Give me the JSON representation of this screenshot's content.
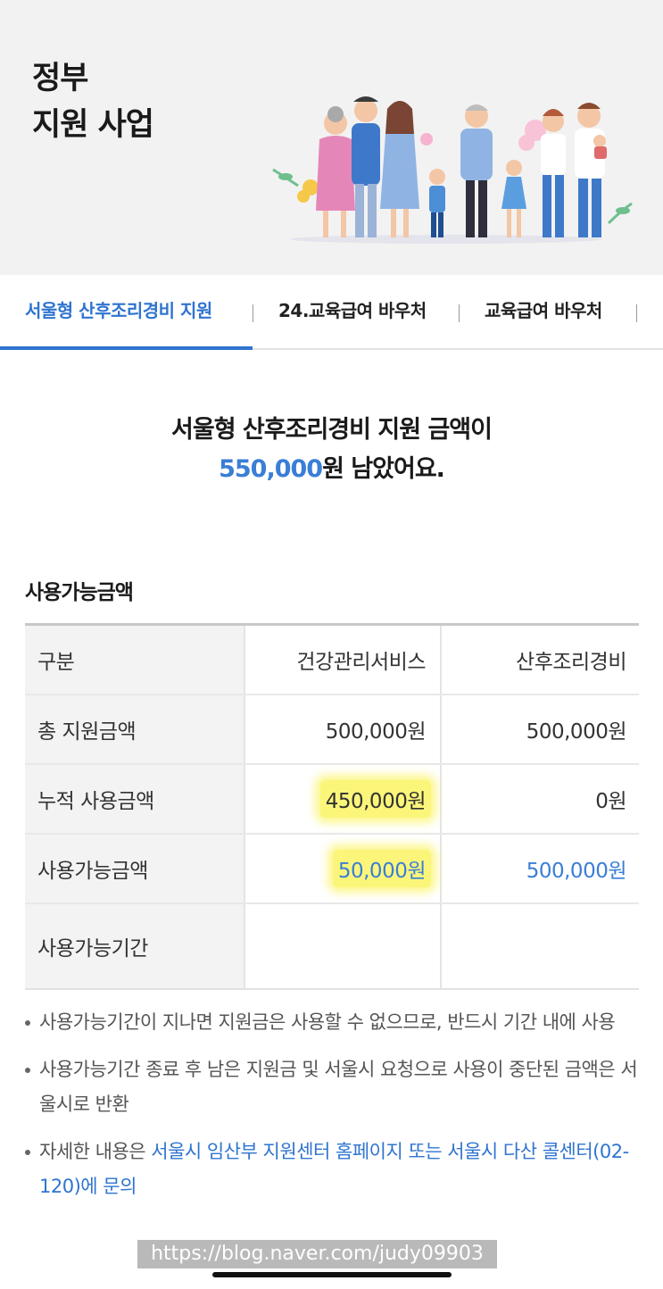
{
  "header": {
    "title_line1": "정부",
    "title_line2": "지원 사업"
  },
  "tabs": [
    {
      "label": "서울형 산후조리경비 지원",
      "active": true
    },
    {
      "label": "24.교육급여 바우처",
      "active": false
    },
    {
      "label": "교육급여 바우처",
      "active": false
    }
  ],
  "summary": {
    "line1": "서울형 산후조리경비 지원 금액이",
    "amount": "550,000",
    "line2_suffix": "원 남았어요."
  },
  "section": {
    "title": "사용가능금액"
  },
  "table": {
    "headers": [
      "구분",
      "건강관리서비스",
      "산후조리경비"
    ],
    "rows": [
      {
        "label": "총 지원금액",
        "health": "500,000원",
        "postnatal": "500,000원"
      },
      {
        "label": "누적 사용금액",
        "health": "450,000원",
        "postnatal": "0원"
      },
      {
        "label": "사용가능금액",
        "health": "50,000원",
        "postnatal": "500,000원"
      },
      {
        "label": "사용가능기간",
        "health": "",
        "postnatal": ""
      }
    ]
  },
  "notes": [
    {
      "text": "사용가능기간이 지나면 지원금은 사용할 수 없으므로, 반드시 기간 내에 사용"
    },
    {
      "text": "사용가능기간 종료 후 남은 지원금 및 서울시 요청으로 사용이 중단된 금액은 서울시로 반환"
    },
    {
      "prefix": "자세한 내용은 ",
      "link": "서울시 임산부 지원센터 홈페이지 또는 서울시 다산 콜센터(02-120)에 문의"
    }
  ],
  "watermark": "https://blog.naver.com/judy09903",
  "colors": {
    "accent": "#2f74d0",
    "amount_blue": "#3a7ed6",
    "highlight": "#fbf67a",
    "header_bg": "#f2f2f2"
  }
}
